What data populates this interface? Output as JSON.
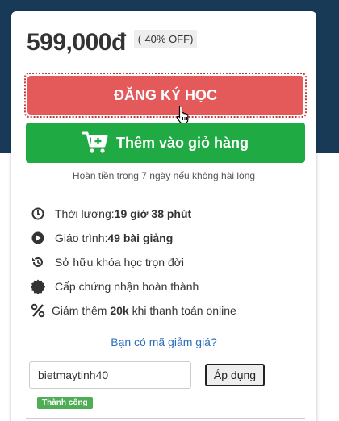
{
  "pricing": {
    "price": "599,000đ",
    "discount": "(-40% OFF)"
  },
  "actions": {
    "register_label": "ĐĂNG KÝ HỌC",
    "cart_label": "Thêm vào giỏ hàng",
    "refund_note": "Hoàn tiền trong 7 ngày nếu không hài lòng"
  },
  "features": [
    {
      "icon": "clock-icon",
      "label": "Thời lượng: ",
      "value": "19 giờ 38 phút"
    },
    {
      "icon": "play-icon",
      "label": "Giáo trình: ",
      "value": "49 bài giảng"
    },
    {
      "icon": "history-icon",
      "label": "Sở hữu khóa học trọn đời",
      "value": ""
    },
    {
      "icon": "certificate-icon",
      "label": "Cấp chứng nhận hoàn thành",
      "value": ""
    },
    {
      "icon": "percent-icon",
      "label_before": "Giảm thêm ",
      "value": "20k",
      "label_after": " khi thanh toán online"
    }
  ],
  "coupon": {
    "link_text": "Bạn có mã giảm giá?",
    "input_value": "bietmaytinh40",
    "apply_label": "Áp dụng",
    "status": "Thành công"
  },
  "colors": {
    "header_bg": "#183a57",
    "register_btn": "#e45a5a",
    "cart_btn": "#1faa43",
    "link": "#2a6fb8",
    "success": "#4fae55"
  }
}
